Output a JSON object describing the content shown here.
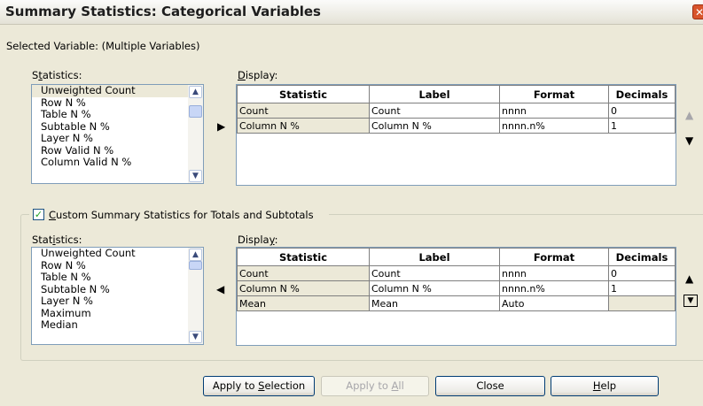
{
  "window": {
    "title": "Summary Statistics: Categorical Variables",
    "close_glyph": "✕"
  },
  "selected_variable": "Selected Variable: (Multiple Variables)",
  "top": {
    "statistics_label_pre": "S",
    "statistics_label_u": "t",
    "statistics_label_post": "atistics:",
    "display_label_u": "D",
    "display_label_post": "isplay:",
    "stat_items": [
      "Unweighted Count",
      "Row N %",
      "Table N %",
      "Subtable N %",
      "Layer N %",
      "Row Valid N %",
      "Column Valid N %"
    ],
    "columns": [
      "Statistic",
      "Label",
      "Format",
      "Decimals"
    ],
    "rows": [
      [
        "Count",
        "Count",
        "nnnn",
        "0"
      ],
      [
        "Column N %",
        "Column N %",
        "nnnn.n%",
        "1"
      ]
    ]
  },
  "custom": {
    "checkbox_u": "C",
    "checkbox_post": "ustom Summary Statistics for Totals and Subtotals",
    "checked": true,
    "check_glyph": "✓",
    "statistics_label_pre": "Stat",
    "statistics_label_u": "i",
    "statistics_label_post": "stics:",
    "display_label_pre": "Displa",
    "display_label_u": "y",
    "display_label_post": ":",
    "stat_items": [
      "Unweighted Count",
      "Row N %",
      "Table N %",
      "Subtable N %",
      "Layer N %",
      "Maximum",
      "Median"
    ],
    "columns": [
      "Statistic",
      "Label",
      "Format",
      "Decimals"
    ],
    "rows": [
      [
        "Count",
        "Count",
        "nnnn",
        "0"
      ],
      [
        "Column N %",
        "Column N %",
        "nnnn.n%",
        "1"
      ],
      [
        "Mean",
        "Mean",
        "Auto",
        ""
      ]
    ]
  },
  "glyphs": {
    "right": "▶",
    "left": "◀",
    "up": "▲",
    "down": "▼",
    "scroll_up": "▲",
    "scroll_down": "▼",
    "thumb": "≡"
  },
  "buttons": {
    "apply_selection_pre": "Apply to ",
    "apply_selection_u": "S",
    "apply_selection_post": "election",
    "apply_all_pre": "Apply to ",
    "apply_all_u": "A",
    "apply_all_post": "ll",
    "close": "Close",
    "help_u": "H",
    "help_post": "elp"
  }
}
